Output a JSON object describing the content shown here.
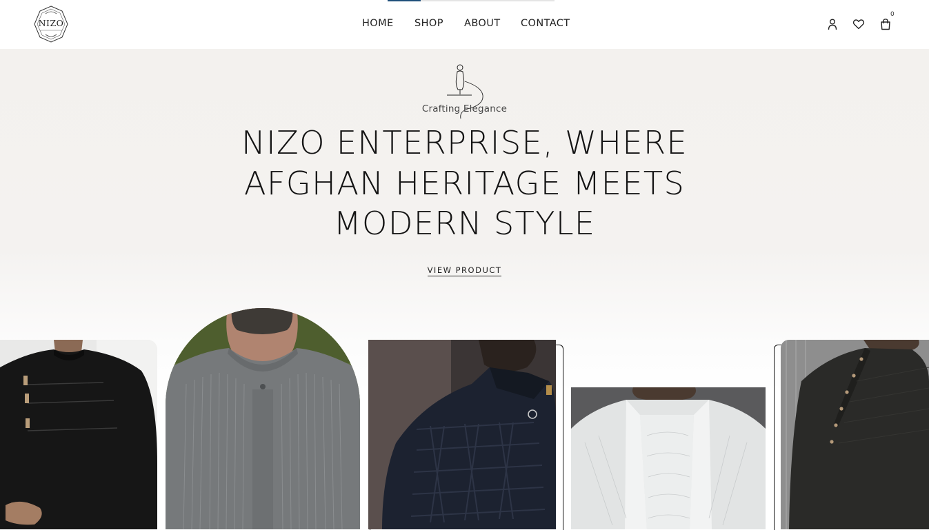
{
  "brand": {
    "logo_text": "NIZO"
  },
  "nav": {
    "items": [
      {
        "label": "HOME"
      },
      {
        "label": "SHOP"
      },
      {
        "label": "ABOUT"
      },
      {
        "label": "CONTACT"
      }
    ]
  },
  "header_icons": {
    "account": "user-icon",
    "wishlist": "heart-icon",
    "cart": "shopping-bag-icon"
  },
  "cart": {
    "count": "0"
  },
  "hero": {
    "tagline": "Crafting Elegance",
    "headline_lines": [
      "NIZO ENTERPRISE, WHERE",
      "AFGHAN HERITAGE MEETS",
      "MODERN STYLE"
    ],
    "cta_label": "VIEW PRODUCT"
  },
  "colors": {
    "hero_background": "#f3f1ee",
    "text": "#141414",
    "progress_fill": "#1f4f7a"
  },
  "top_progress": {
    "fraction": 0.2
  },
  "products": [
    {
      "name": "black-kurta-with-buttons"
    },
    {
      "name": "grey-pintuck-kurta"
    },
    {
      "name": "navy-textured-jacket"
    },
    {
      "name": "white-embroidered-sherwani"
    },
    {
      "name": "black-side-button-kurta"
    }
  ]
}
